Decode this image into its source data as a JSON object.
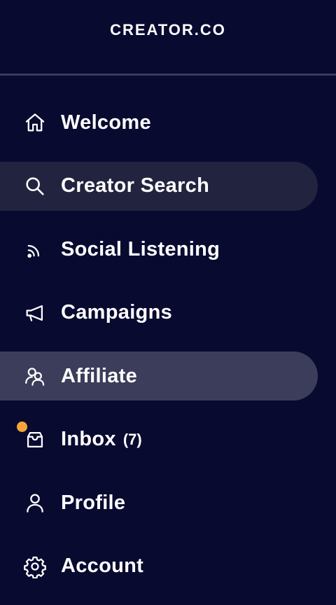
{
  "brand": {
    "logo": "CREATOR.CO"
  },
  "nav": {
    "items": [
      {
        "label": "Welcome",
        "icon": "home-icon"
      },
      {
        "label": "Creator Search",
        "icon": "search-icon"
      },
      {
        "label": "Social Listening",
        "icon": "rss-icon"
      },
      {
        "label": "Campaigns",
        "icon": "megaphone-icon"
      },
      {
        "label": "Affiliate",
        "icon": "users-icon"
      },
      {
        "label": "Inbox",
        "icon": "inbox-icon",
        "count": "(7)"
      },
      {
        "label": "Profile",
        "icon": "user-icon"
      },
      {
        "label": "Account",
        "icon": "gear-icon"
      }
    ],
    "hovered_item": "Creator Search",
    "active_item": "Affiliate"
  },
  "colors": {
    "background": "#080a30",
    "active_bg": "#3b3d5a",
    "hover_bg": "#22243f",
    "divider": "#3a3c5c",
    "notification_dot": "#f5a53a"
  }
}
